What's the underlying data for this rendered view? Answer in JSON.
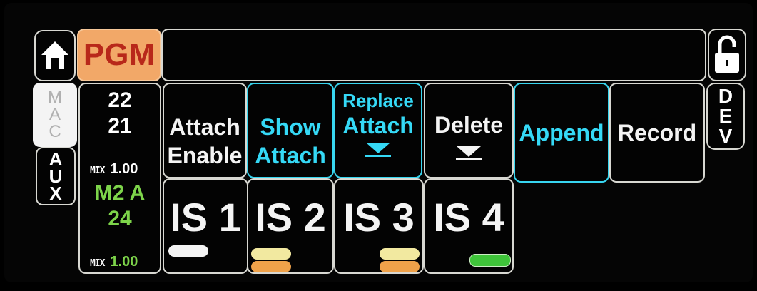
{
  "top_bar": {
    "pgm_label": "PGM",
    "message": ""
  },
  "side_tabs": {
    "mac_letters": [
      "M",
      "A",
      "C"
    ],
    "aux_letters": [
      "A",
      "U",
      "X"
    ],
    "dev_letters": [
      "D",
      "E",
      "V"
    ]
  },
  "status": {
    "line1": "22",
    "line2": "21",
    "mix1_label": "MIX",
    "mix1_value": "1.00",
    "m2_label": "M2 A",
    "m2_value": "24",
    "mix2_label": "MIX",
    "mix2_value": "1.00"
  },
  "buttons": [
    {
      "lines": [
        "Attach",
        "Enable"
      ],
      "color": "#f4f4f4"
    },
    {
      "lines": [
        "Show",
        "Attach"
      ],
      "color": "#35d9f6"
    },
    {
      "lines": [
        "Replace",
        "Attach"
      ],
      "color": "#35d9f6"
    },
    {
      "lines": [
        "Delete"
      ],
      "color": "#f4f4f4"
    },
    {
      "lines": [
        "Append"
      ],
      "color": "#35d9f6"
    },
    {
      "lines": [
        "Record"
      ],
      "color": "#f4f4f4"
    }
  ],
  "slots": [
    {
      "label": "IS 1"
    },
    {
      "label": "IS 2"
    },
    {
      "label": "IS 3"
    },
    {
      "label": "IS 4"
    }
  ],
  "colors": {
    "pgm_bg": "#f2a868",
    "pgm_text": "#b8281a",
    "cyan": "#35d9f6",
    "green": "#7dd44a",
    "tally_white": "#f4f4f4",
    "tally_orange": "#f0a24a",
    "tally_yellow": "#f2e9a0",
    "tally_green": "#3fc43a"
  },
  "icons": [
    "home-icon",
    "unlock-icon",
    "triangle-down-icon"
  ]
}
